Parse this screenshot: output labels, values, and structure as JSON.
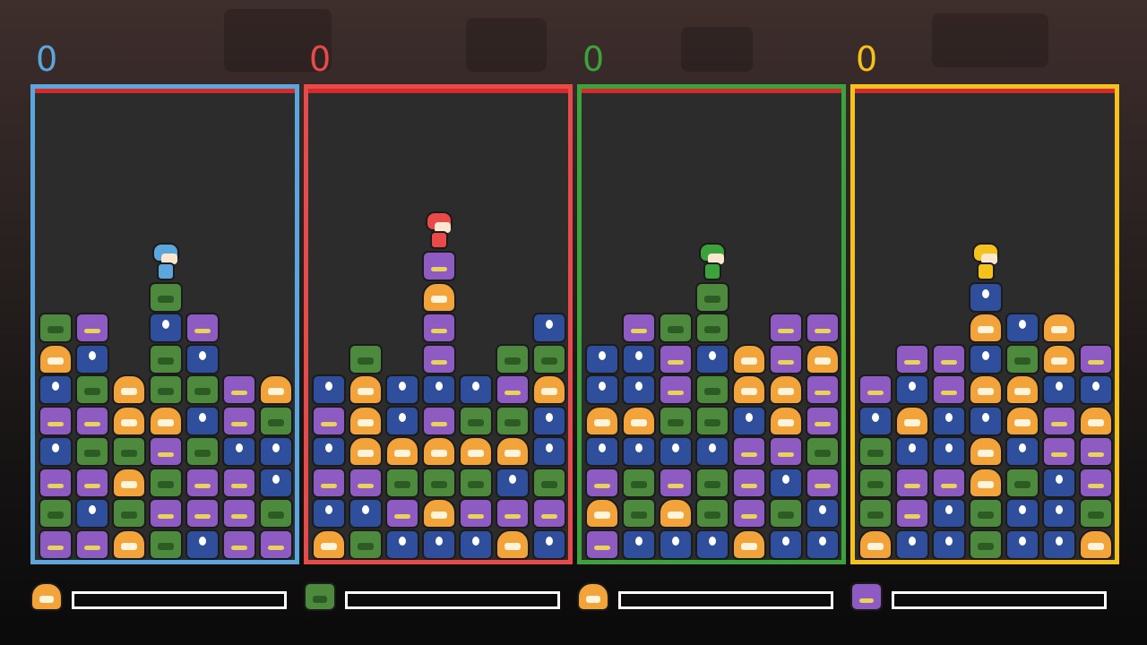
{
  "colors": {
    "blue": "#5ba7dd",
    "red": "#e84a4a",
    "green": "#3ca33c",
    "yellow": "#f5c21d",
    "well_background": "#2d2c2c",
    "danger_line": "#d42a2a"
  },
  "players": [
    {
      "score": "0",
      "color": "blue",
      "character": "blue-cat-hood-character",
      "next_piece": "orange",
      "columns": [
        [
          "purple",
          "green",
          "purple",
          "blue",
          "purple",
          "blue",
          "orange",
          "green"
        ],
        [
          "purple",
          "blue",
          "purple",
          "green",
          "purple",
          "green",
          "blue",
          "purple"
        ],
        [
          "orange",
          "green",
          "orange",
          "green",
          "orange",
          "orange"
        ],
        [
          "green",
          "purple",
          "green",
          "purple",
          "orange",
          "green",
          "green",
          "blue",
          "green"
        ],
        [
          "blue",
          "purple",
          "purple",
          "green",
          "blue",
          "green",
          "blue",
          "purple"
        ],
        [
          "purple",
          "purple",
          "purple",
          "blue",
          "purple",
          "purple"
        ],
        [
          "purple",
          "green",
          "blue",
          "blue",
          "green",
          "orange"
        ]
      ]
    },
    {
      "score": "0",
      "color": "red",
      "character": "red-cat-hood-character",
      "next_piece": "green",
      "columns": [
        [
          "orange",
          "blue",
          "purple",
          "blue",
          "purple",
          "blue"
        ],
        [
          "green",
          "blue",
          "purple",
          "orange",
          "orange",
          "orange",
          "green"
        ],
        [
          "blue",
          "purple",
          "green",
          "orange",
          "blue",
          "blue"
        ],
        [
          "blue",
          "orange",
          "green",
          "orange",
          "purple",
          "blue",
          "purple",
          "purple",
          "orange",
          "purple"
        ],
        [
          "blue",
          "purple",
          "green",
          "orange",
          "green",
          "blue"
        ],
        [
          "orange",
          "purple",
          "blue",
          "orange",
          "green",
          "purple",
          "green"
        ],
        [
          "blue",
          "purple",
          "green",
          "blue",
          "blue",
          "orange",
          "green",
          "blue"
        ]
      ]
    },
    {
      "score": "0",
      "color": "green",
      "character": "green-dino-hood-character",
      "next_piece": "orange",
      "columns": [
        [
          "purple",
          "orange",
          "purple",
          "blue",
          "orange",
          "blue",
          "blue"
        ],
        [
          "blue",
          "green",
          "green",
          "blue",
          "orange",
          "blue",
          "blue",
          "purple"
        ],
        [
          "blue",
          "orange",
          "purple",
          "blue",
          "green",
          "purple",
          "purple",
          "green"
        ],
        [
          "blue",
          "green",
          "green",
          "blue",
          "green",
          "green",
          "blue",
          "green",
          "green"
        ],
        [
          "orange",
          "purple",
          "purple",
          "purple",
          "blue",
          "orange",
          "orange"
        ],
        [
          "blue",
          "green",
          "blue",
          "purple",
          "orange",
          "orange",
          "purple",
          "purple"
        ],
        [
          "blue",
          "blue",
          "purple",
          "green",
          "purple",
          "purple",
          "orange",
          "purple"
        ]
      ]
    },
    {
      "score": "0",
      "color": "yellow",
      "character": "yellow-cat-hood-character",
      "next_piece": "purple",
      "columns": [
        [
          "orange",
          "green",
          "green",
          "green",
          "blue",
          "purple"
        ],
        [
          "blue",
          "purple",
          "purple",
          "blue",
          "orange",
          "blue",
          "purple"
        ],
        [
          "blue",
          "blue",
          "purple",
          "blue",
          "blue",
          "purple",
          "purple"
        ],
        [
          "green",
          "green",
          "orange",
          "orange",
          "blue",
          "orange",
          "blue",
          "orange",
          "blue"
        ],
        [
          "blue",
          "blue",
          "green",
          "blue",
          "orange",
          "orange",
          "green",
          "blue"
        ],
        [
          "blue",
          "blue",
          "blue",
          "purple",
          "purple",
          "blue",
          "orange",
          "orange"
        ],
        [
          "orange",
          "green",
          "purple",
          "purple",
          "orange",
          "blue",
          "purple"
        ]
      ]
    }
  ]
}
